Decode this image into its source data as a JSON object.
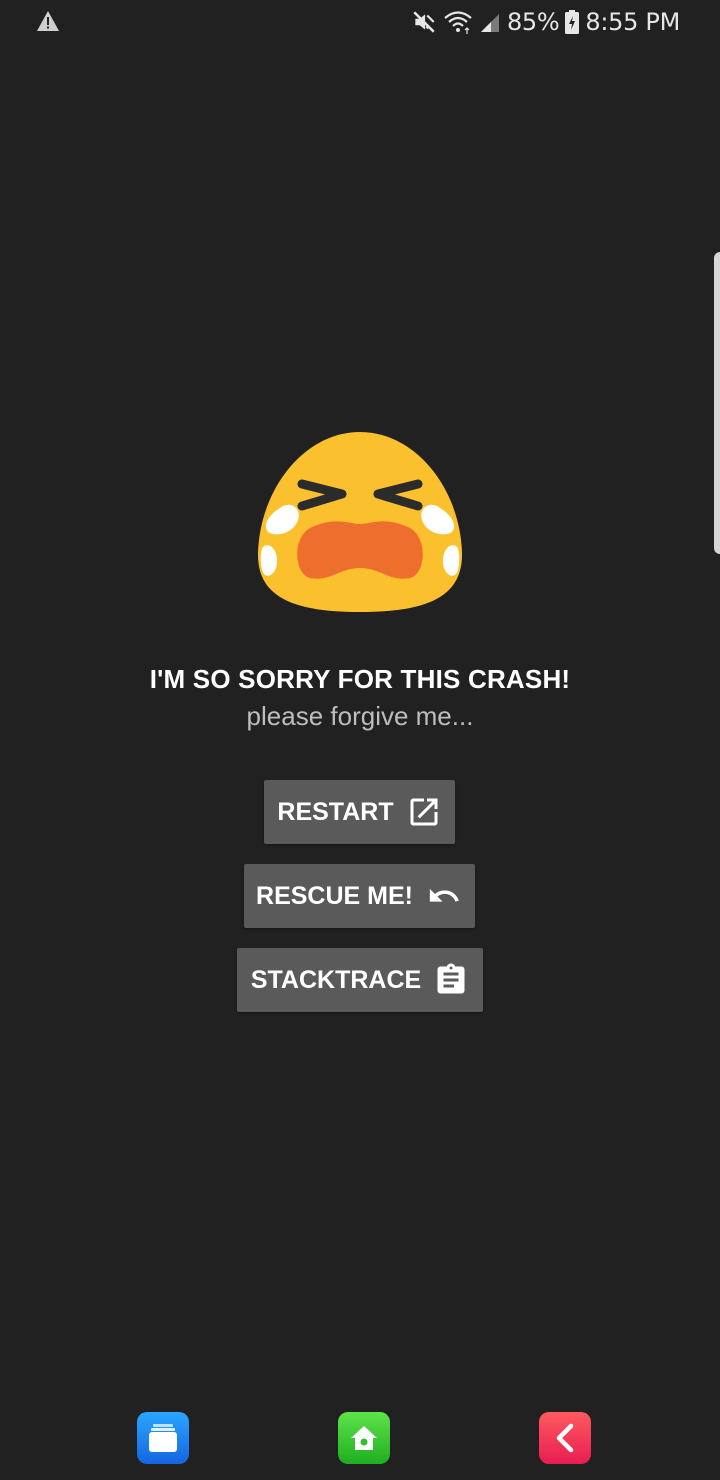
{
  "status_bar": {
    "battery_percent": "85%",
    "time": "8:55 PM",
    "icons": [
      "warning-icon",
      "mute-icon",
      "wifi-icon",
      "signal-icon",
      "battery-charging-icon"
    ]
  },
  "crash": {
    "emoji": "loudly-crying-face",
    "title": "I'M SO SORRY FOR THIS CRASH!",
    "subtitle": "please forgive me..."
  },
  "buttons": {
    "restart": "RESTART",
    "rescue": "RESCUE ME!",
    "stacktrace": "STACKTRACE"
  },
  "dock": {
    "icons": [
      "files-icon",
      "home-icon",
      "back-icon"
    ]
  },
  "colors": {
    "background": "#212121",
    "button": "#5a5a5a",
    "emoji_yellow": "#fbc02d",
    "emoji_mouth": "#ee6e2e"
  }
}
